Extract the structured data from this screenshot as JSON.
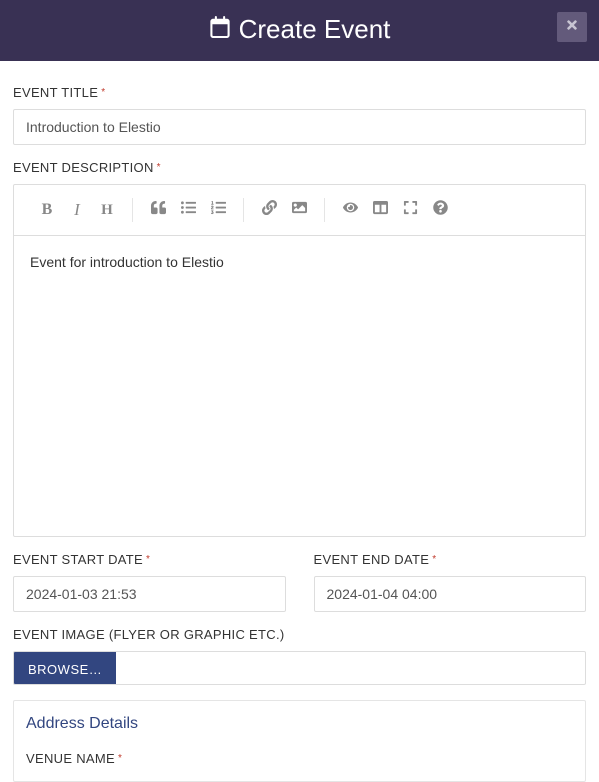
{
  "header": {
    "title": "Create Event"
  },
  "fields": {
    "title": {
      "label": "Event Title",
      "value": "Introduction to Elestio"
    },
    "description": {
      "label": "Event Description",
      "content": "Event for introduction to Elestio"
    },
    "startDate": {
      "label": "Event Start Date",
      "value": "2024-01-03 21:53"
    },
    "endDate": {
      "label": "Event End Date",
      "value": "2024-01-04 04:00"
    },
    "image": {
      "label": "Event Image (Flyer or Graphic etc.)",
      "browse": "BROWSE…"
    }
  },
  "panel": {
    "title": "Address Details",
    "venueName": {
      "label": "Venue Name"
    }
  },
  "toolbar": {
    "bold": "B",
    "italic": "I",
    "heading": "H"
  }
}
